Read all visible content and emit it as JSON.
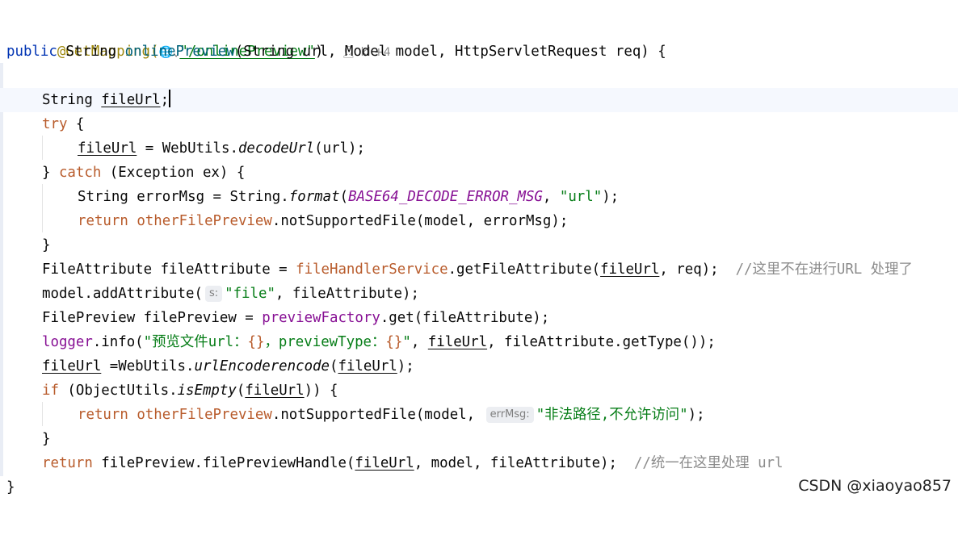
{
  "annotation_line": {
    "annotation": "@GetMapping(",
    "globe_icon": "🌐",
    "dropdown_icon": "⌄",
    "path": "\"/onlinePreview\"",
    "close": ")",
    "author_icon": "person-icon",
    "author": "kl +4"
  },
  "signature": {
    "public": "public",
    "type": "String",
    "name": "onlinePreview",
    "params": "(String url, Model model, HttpServletRequest req) {"
  },
  "lines": {
    "l3a": "String ",
    "l3b": "fileUrl",
    "l3c": ";",
    "l4a": "try",
    "l4b": " {",
    "l5a": "fileUrl",
    "l5b": " = WebUtils.",
    "l5c": "decodeUrl",
    "l5d": "(url);",
    "l6a": "} ",
    "l6b": "catch",
    "l6c": " (Exception ex) {",
    "l7a": "String errorMsg = String.",
    "l7b": "format",
    "l7c": "(",
    "l7d": "BASE64_DECODE_ERROR_MSG",
    "l7e": ", ",
    "l7f": "\"url\"",
    "l7g": ");",
    "l8a": "return",
    "l8b": " ",
    "l8c": "otherFilePreview",
    "l8d": ".notSupportedFile(model, errorMsg);",
    "l9a": "}",
    "l10a": "FileAttribute fileAttribute = ",
    "l10b": "fileHandlerService",
    "l10c": ".getFileAttribute(",
    "l10d": "fileUrl",
    "l10e": ", req);  ",
    "l10f": "//这里不在进行URL 处理了",
    "l11a": "model.addAttribute(",
    "l11hint": "s:",
    "l11b": "\"file\"",
    "l11c": ", fileAttribute);",
    "l12a": "FilePreview filePreview = ",
    "l12b": "previewFactory",
    "l12c": ".get(fileAttribute);",
    "l13a": "logger",
    "l13b": ".info(",
    "l13c": "\"预览文件url：",
    "l13d": "{}",
    "l13e": "，previewType：",
    "l13f": "{}",
    "l13g": "\"",
    "l13h": ", ",
    "l13i": "fileUrl",
    "l13j": ", fileAttribute.getType());",
    "l14a": "fileUrl",
    "l14b": " =WebUtils.",
    "l14c": "urlEncoderencode",
    "l14d": "(",
    "l14e": "fileUrl",
    "l14f": ");",
    "l15a": "if",
    "l15b": " (ObjectUtils.",
    "l15c": "isEmpty",
    "l15d": "(",
    "l15e": "fileUrl",
    "l15f": ")) {",
    "l16a": "return",
    "l16b": " ",
    "l16c": "otherFilePreview",
    "l16d": ".notSupportedFile(model, ",
    "l16hint": "errMsg:",
    "l16e": "\"非法路径,不允许访问\"",
    "l16f": ");",
    "l17a": "}",
    "l18a": "return",
    "l18b": " filePreview.filePreviewHandle(",
    "l18c": "fileUrl",
    "l18d": ", model, fileAttribute);  ",
    "l18e": "//统一在这里处理 url",
    "l19a": "}"
  },
  "watermark": "CSDN @xiaoyao857"
}
